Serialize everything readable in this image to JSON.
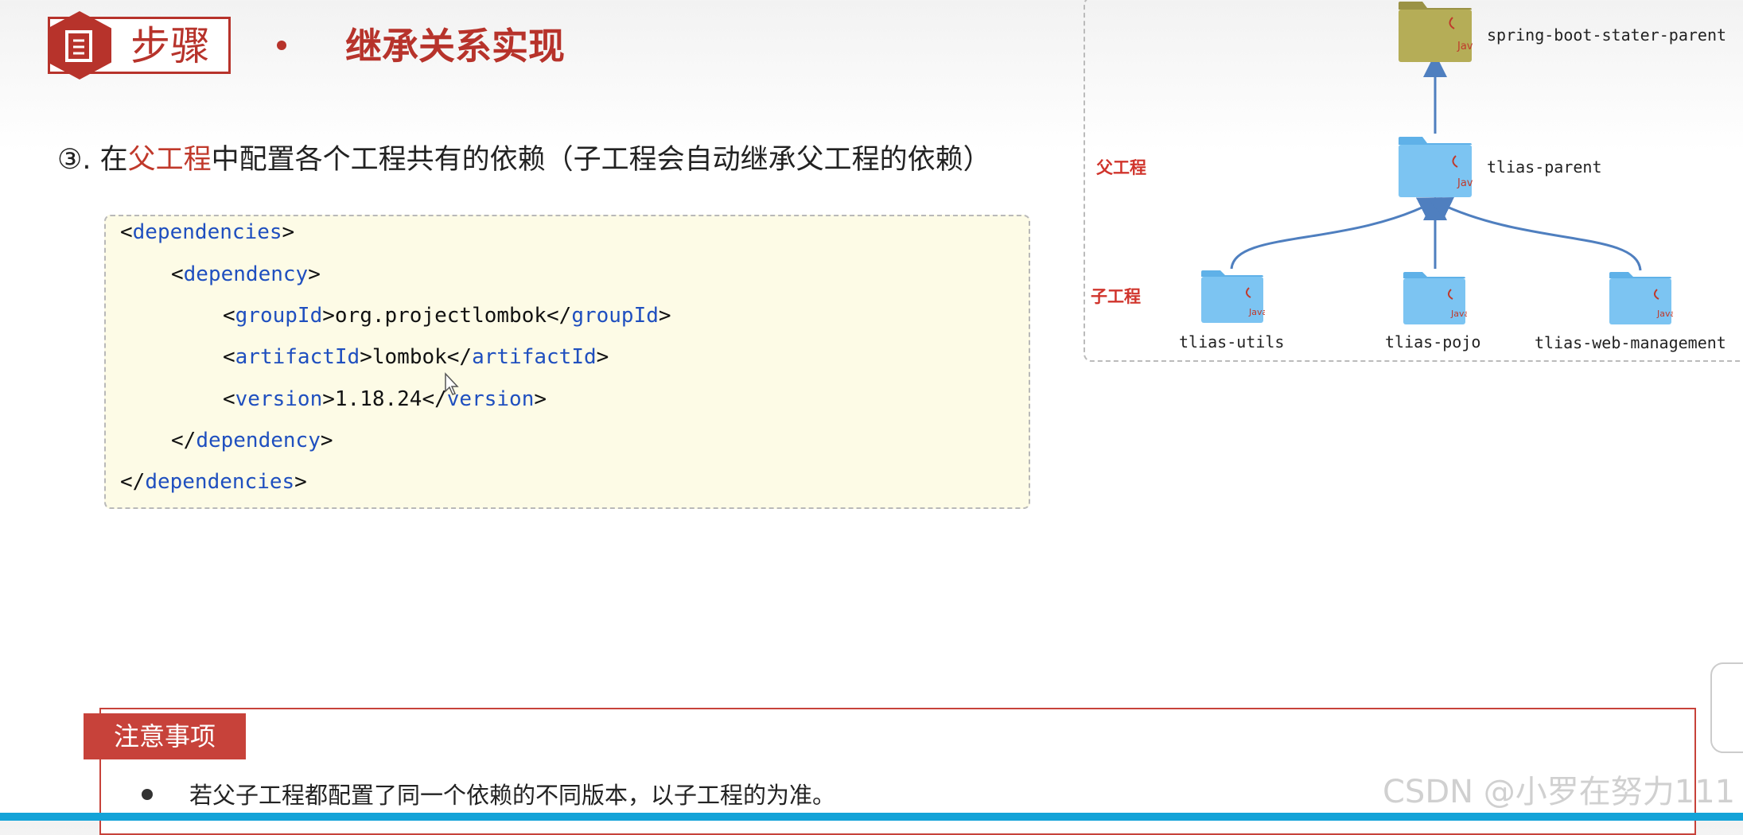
{
  "header": {
    "step_label": "步骤",
    "title": "继承关系实现"
  },
  "step": {
    "prefix": "③. 在",
    "highlight": "父工程",
    "suffix": "中配置各个工程共有的依赖（子工程会自动继承父工程的依赖）"
  },
  "code": {
    "lines": [
      {
        "open": "<",
        "tag": "dependencies",
        "close": ">",
        "text": "",
        "end_open": "",
        "end_tag": "",
        "end_close": ""
      },
      {
        "open": "<",
        "tag": "dependency",
        "close": ">",
        "text": "",
        "end_open": "",
        "end_tag": "",
        "end_close": ""
      },
      {
        "open": "<",
        "tag": "groupId",
        "close": ">",
        "text": "org.projectlombok",
        "end_open": "</",
        "end_tag": "groupId",
        "end_close": ">"
      },
      {
        "open": "<",
        "tag": "artifactId",
        "close": ">",
        "text": "lombok",
        "end_open": "</",
        "end_tag": "artifactId",
        "end_close": ">"
      },
      {
        "open": "<",
        "tag": "version",
        "close": ">",
        "text": "1.18.24",
        "end_open": "</",
        "end_tag": "version",
        "end_close": ">"
      },
      {
        "open": "</",
        "tag": "dependency",
        "close": ">",
        "text": "",
        "end_open": "",
        "end_tag": "",
        "end_close": ""
      },
      {
        "open": "</",
        "tag": "dependencies",
        "close": ">",
        "text": "",
        "end_open": "",
        "end_tag": "",
        "end_close": ""
      }
    ]
  },
  "diagram": {
    "parent_side_label": "父工程",
    "child_side_label": "子工程",
    "root_node": "spring-boot-stater-parent",
    "parent_node": "tlias-parent",
    "children": [
      "tlias-utils",
      "tlias-pojo",
      "tlias-web-management"
    ],
    "java_label": "Java",
    "colors": {
      "folder_blue": "#7cc4f2",
      "folder_olive": "#b5ad57",
      "arrow": "#4f7fbf"
    }
  },
  "notice": {
    "tag": "注意事项",
    "text": "若父子工程都配置了同一个依赖的不同版本，以子工程的为准。"
  },
  "watermark": "CSDN @小罗在努力111",
  "colors": {
    "accent_red": "#b7332b",
    "code_tag_blue": "#1f4fbf",
    "code_bg": "#fdfbe6",
    "bottom_bar": "#14a3d8"
  }
}
